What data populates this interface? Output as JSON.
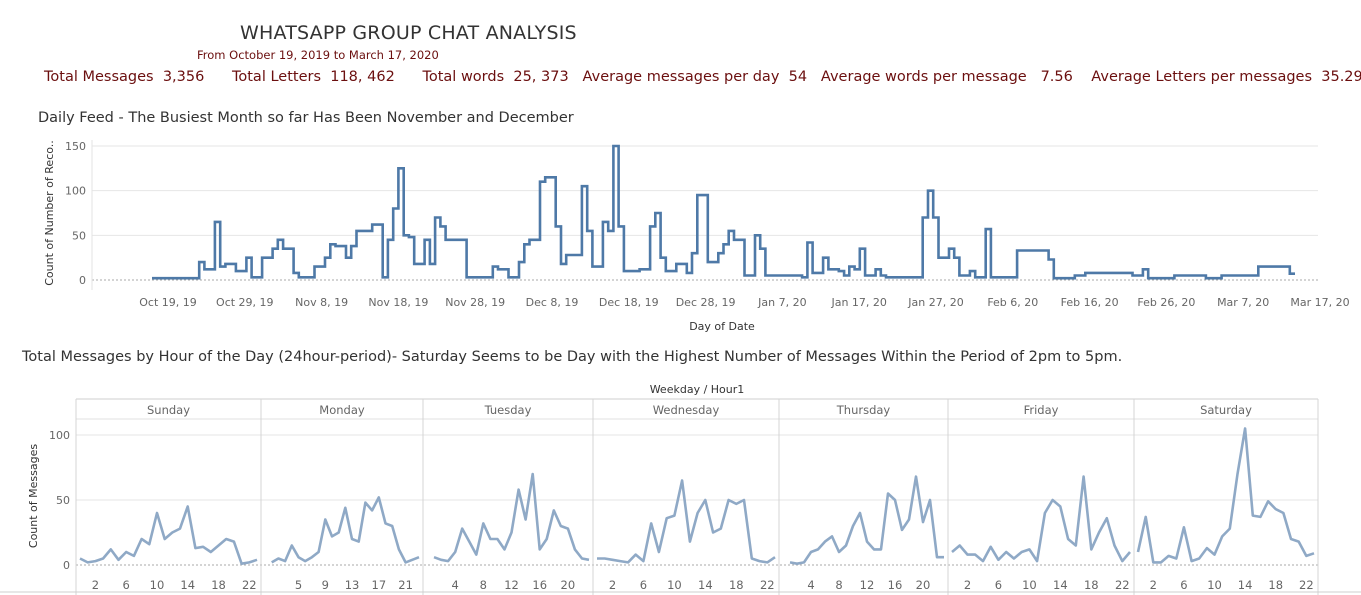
{
  "header": {
    "title": "WHATSAPP GROUP CHAT ANALYSIS",
    "subtitle": "From October 19, 2019 to March 17, 2020",
    "stats": [
      {
        "label": "Total Messages",
        "value": "3,356"
      },
      {
        "label": "Total Letters",
        "value": "118, 462"
      },
      {
        "label": "Total words",
        "value": "25, 373"
      },
      {
        "label": "Average messages per day",
        "value": "54"
      },
      {
        "label": "Average words per message",
        "value": "7.56"
      },
      {
        "label": "Average Letters per messages",
        "value": "35.29"
      }
    ]
  },
  "colors": {
    "daily_line": "#4e79a7",
    "hourly_line": "#8fa9c6",
    "stats_text": "#6b0f0f",
    "grid": "#e6e6e6"
  },
  "chart_data": [
    {
      "type": "line",
      "title": "Daily Feed - The Busiest Month so far Has Been November and December",
      "xlabel": "Day of Date",
      "ylabel": "Count of Number of Reco..",
      "x_tick_labels": [
        "Oct 19, 19",
        "Oct 29, 19",
        "Nov 8, 19",
        "Nov 18, 19",
        "Nov 28, 19",
        "Dec 8, 19",
        "Dec 18, 19",
        "Dec 28, 19",
        "Jan 7, 20",
        "Jan 17, 20",
        "Jan 27, 20",
        "Feb 6, 20",
        "Feb 16, 20",
        "Feb 26, 20",
        "Mar 7, 20",
        "Mar 17, 20"
      ],
      "y_ticks": [
        0,
        50,
        100,
        150
      ],
      "ylim": [
        0,
        150
      ],
      "step": true,
      "series": [
        {
          "values": [
            2,
            2,
            2,
            2,
            2,
            2,
            2,
            2,
            2,
            20,
            12,
            12,
            65,
            15,
            18,
            18,
            10,
            10,
            25,
            3,
            3,
            25,
            25,
            35,
            45,
            35,
            35,
            8,
            3,
            3,
            3,
            15,
            15,
            25,
            40,
            38,
            38,
            25,
            38,
            55,
            55,
            55,
            62,
            62,
            3,
            45,
            80,
            125,
            50,
            48,
            18,
            18,
            45,
            18,
            70,
            60,
            45,
            45,
            45,
            45,
            3,
            3,
            3,
            3,
            3,
            15,
            12,
            12,
            3,
            3,
            20,
            40,
            45,
            45,
            110,
            115,
            115,
            60,
            18,
            28,
            28,
            28,
            105,
            55,
            15,
            15,
            65,
            55,
            150,
            60,
            10,
            10,
            10,
            12,
            12,
            60,
            75,
            25,
            10,
            10,
            18,
            18,
            8,
            30,
            95,
            95,
            20,
            20,
            30,
            40,
            55,
            45,
            45,
            5,
            5,
            50,
            35,
            5,
            5,
            5,
            5,
            5,
            5,
            5,
            3,
            42,
            8,
            8,
            25,
            12,
            12,
            10,
            5,
            15,
            12,
            35,
            5,
            5,
            12,
            5,
            3,
            3,
            3,
            3,
            3,
            3,
            3,
            70,
            100,
            70,
            25,
            25,
            35,
            25,
            5,
            5,
            10,
            3,
            3,
            57,
            3,
            3,
            3,
            3,
            3,
            33,
            33,
            33,
            33,
            33,
            33,
            23,
            2,
            2,
            2,
            2,
            5,
            5,
            8,
            8,
            8,
            8,
            8,
            8,
            8,
            8,
            8,
            5,
            5,
            12,
            2,
            2,
            2,
            2,
            2,
            5,
            5,
            5,
            5,
            5,
            5,
            2,
            2,
            2,
            5,
            5,
            5,
            5,
            5,
            5,
            5,
            15,
            15,
            15,
            15,
            15,
            15,
            7
          ]
        }
      ]
    },
    {
      "type": "line",
      "title": "Total Messages by Hour of the Day (24hour-period)-  Saturday Seems to be Day with the Highest Number of Messages Within the Period of 2pm to 5pm.",
      "header": "Weekday / Hour1",
      "ylabel": "Count of Messages",
      "y_ticks": [
        0,
        50,
        100
      ],
      "ylim": [
        0,
        110
      ],
      "panels": [
        {
          "name": "Sunday",
          "tick_labels": [
            "2",
            "6",
            "10",
            "14",
            "18",
            "22"
          ],
          "tick_hours": [
            2,
            6,
            10,
            14,
            18,
            22
          ],
          "hours": [
            0,
            1,
            2,
            3,
            4,
            5,
            6,
            7,
            8,
            9,
            10,
            11,
            12,
            13,
            14,
            15,
            16,
            17,
            18,
            19,
            20,
            21,
            22,
            23
          ],
          "values": [
            5,
            2,
            3,
            5,
            12,
            4,
            10,
            7,
            20,
            16,
            40,
            20,
            25,
            28,
            45,
            13,
            14,
            10,
            15,
            20,
            18,
            1,
            2,
            4
          ]
        },
        {
          "name": "Monday",
          "tick_labels": [
            "5",
            "9",
            "13",
            "17",
            "21"
          ],
          "tick_hours": [
            5,
            9,
            13,
            17,
            21
          ],
          "hours": [
            1,
            2,
            3,
            4,
            5,
            6,
            7,
            8,
            9,
            10,
            11,
            12,
            13,
            14,
            15,
            16,
            17,
            18,
            19,
            20,
            21,
            22,
            23
          ],
          "values": [
            2,
            5,
            3,
            15,
            6,
            3,
            6,
            10,
            35,
            22,
            25,
            44,
            20,
            18,
            48,
            42,
            52,
            32,
            30,
            12,
            2,
            4,
            6
          ]
        },
        {
          "name": "Tuesday",
          "tick_labels": [
            "4",
            "8",
            "12",
            "16",
            "20"
          ],
          "tick_hours": [
            4,
            8,
            12,
            16,
            20
          ],
          "hours": [
            1,
            2,
            3,
            4,
            5,
            6,
            7,
            8,
            9,
            10,
            11,
            12,
            13,
            14,
            15,
            16,
            17,
            18,
            19,
            20,
            21,
            22,
            23
          ],
          "values": [
            6,
            4,
            3,
            10,
            28,
            18,
            8,
            32,
            20,
            20,
            12,
            25,
            58,
            35,
            70,
            12,
            20,
            42,
            30,
            28,
            12,
            5,
            4
          ]
        },
        {
          "name": "Wednesday",
          "tick_labels": [
            "2",
            "6",
            "10",
            "14",
            "18",
            "22"
          ],
          "tick_hours": [
            2,
            6,
            10,
            14,
            18,
            22
          ],
          "hours": [
            0,
            1,
            2,
            3,
            4,
            5,
            6,
            7,
            8,
            9,
            10,
            11,
            12,
            13,
            14,
            15,
            16,
            17,
            18,
            19,
            20,
            21,
            22,
            23
          ],
          "values": [
            5,
            5,
            4,
            3,
            2,
            8,
            3,
            32,
            10,
            36,
            38,
            65,
            18,
            40,
            50,
            25,
            28,
            50,
            47,
            50,
            5,
            3,
            2,
            6
          ]
        },
        {
          "name": "Thursday",
          "tick_labels": [
            "4",
            "8",
            "12",
            "16",
            "20"
          ],
          "tick_hours": [
            4,
            8,
            12,
            16,
            20
          ],
          "hours": [
            1,
            2,
            3,
            4,
            5,
            6,
            7,
            8,
            9,
            10,
            11,
            12,
            13,
            14,
            15,
            16,
            17,
            18,
            19,
            20,
            21,
            22,
            23
          ],
          "values": [
            2,
            1,
            2,
            10,
            12,
            18,
            22,
            10,
            15,
            30,
            40,
            18,
            12,
            12,
            55,
            50,
            27,
            35,
            68,
            33,
            50,
            6,
            6
          ]
        },
        {
          "name": "Friday",
          "tick_labels": [
            "2",
            "6",
            "10",
            "14",
            "18",
            "22"
          ],
          "tick_hours": [
            2,
            6,
            10,
            14,
            18,
            22
          ],
          "hours": [
            0,
            1,
            2,
            3,
            4,
            5,
            6,
            7,
            8,
            9,
            10,
            11,
            12,
            13,
            14,
            15,
            16,
            17,
            18,
            19,
            20,
            21,
            22,
            23
          ],
          "values": [
            10,
            15,
            8,
            8,
            3,
            14,
            4,
            10,
            5,
            10,
            12,
            3,
            40,
            50,
            45,
            20,
            15,
            68,
            12,
            25,
            36,
            15,
            3,
            10
          ]
        },
        {
          "name": "Saturday",
          "tick_labels": [
            "2",
            "6",
            "10",
            "14",
            "18",
            "22"
          ],
          "tick_hours": [
            2,
            6,
            10,
            14,
            18,
            22
          ],
          "hours": [
            0,
            1,
            2,
            3,
            4,
            5,
            6,
            7,
            8,
            9,
            10,
            11,
            12,
            13,
            14,
            15,
            16,
            17,
            18,
            19,
            20,
            21,
            22,
            23
          ],
          "values": [
            10,
            37,
            2,
            2,
            7,
            5,
            29,
            3,
            5,
            13,
            8,
            22,
            28,
            70,
            105,
            38,
            37,
            49,
            43,
            40,
            20,
            18,
            7,
            9
          ]
        }
      ]
    }
  ]
}
